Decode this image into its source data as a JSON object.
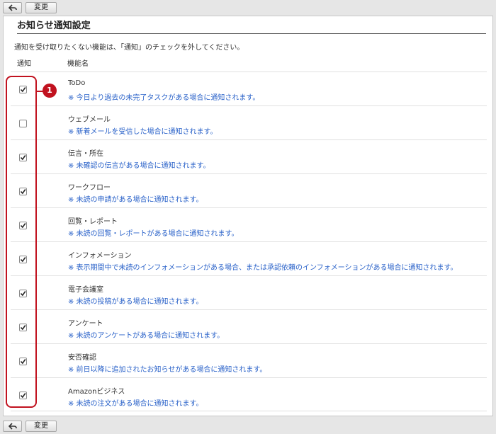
{
  "toolbar": {
    "back_icon": "back-arrow-icon",
    "change_label": "変更"
  },
  "section": {
    "title": "お知らせ通知設定",
    "description": "通知を受け取りたくない機能は、「通知」のチェックを外してください。",
    "col_notify": "通知",
    "col_function": "機能名"
  },
  "callout": {
    "number": "1"
  },
  "colors": {
    "link": "#2a62c9",
    "highlight": "#c1121f"
  },
  "rows": [
    {
      "name": "ToDo",
      "note": "※ 今日より過去の未完了タスクがある場合に通知されます。",
      "checked": true
    },
    {
      "name": "ウェブメール",
      "note": "※ 新着メールを受信した場合に通知されます。",
      "checked": false
    },
    {
      "name": "伝言・所在",
      "note": "※ 未確認の伝言がある場合に通知されます。",
      "checked": true
    },
    {
      "name": "ワークフロー",
      "note": "※ 未読の申請がある場合に通知されます。",
      "checked": true
    },
    {
      "name": "回覧・レポート",
      "note": "※ 未読の回覧・レポートがある場合に通知されます。",
      "checked": true
    },
    {
      "name": "インフォメーション",
      "note": "※ 表示期間中で未読のインフォメーションがある場合、または承認依頼のインフォメーションがある場合に通知されます。",
      "checked": true
    },
    {
      "name": "電子会議室",
      "note": "※ 未読の投稿がある場合に通知されます。",
      "checked": true
    },
    {
      "name": "アンケート",
      "note": "※ 未読のアンケートがある場合に通知されます。",
      "checked": true
    },
    {
      "name": "安否確認",
      "note": "※ 前日以降に追加されたお知らせがある場合に通知されます。",
      "checked": true
    },
    {
      "name": "Amazonビジネス",
      "note": "※ 未読の注文がある場合に通知されます。",
      "checked": true
    }
  ]
}
